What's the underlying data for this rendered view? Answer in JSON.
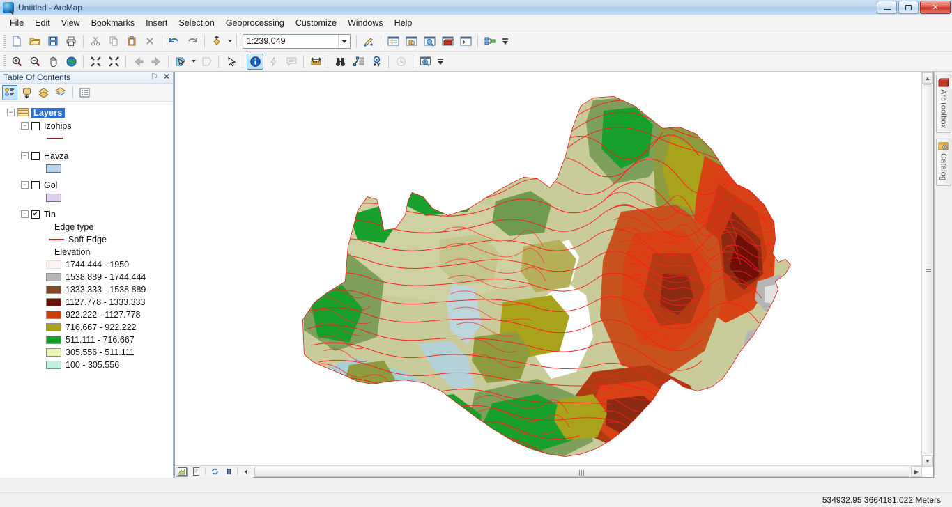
{
  "window": {
    "title": "Untitled - ArcMap",
    "app_icon": "arcmap-globe-icon",
    "minimize_label": "Minimize",
    "maximize_label": "Restore",
    "close_label": "Close"
  },
  "menubar": {
    "items": [
      {
        "label": "File"
      },
      {
        "label": "Edit"
      },
      {
        "label": "View"
      },
      {
        "label": "Bookmarks"
      },
      {
        "label": "Insert"
      },
      {
        "label": "Selection"
      },
      {
        "label": "Geoprocessing"
      },
      {
        "label": "Customize"
      },
      {
        "label": "Windows"
      },
      {
        "label": "Help"
      }
    ]
  },
  "standard_toolbar": {
    "buttons": [
      {
        "name": "new-map-icon",
        "title": "New"
      },
      {
        "name": "open-folder-icon",
        "title": "Open"
      },
      {
        "name": "save-icon",
        "title": "Save"
      },
      {
        "name": "print-icon",
        "title": "Print"
      },
      {
        "name": "cut-icon",
        "title": "Cut"
      },
      {
        "name": "copy-icon",
        "title": "Copy"
      },
      {
        "name": "paste-icon",
        "title": "Paste"
      },
      {
        "name": "delete-icon",
        "title": "Delete"
      },
      {
        "name": "undo-icon",
        "title": "Undo"
      },
      {
        "name": "redo-icon",
        "title": "Redo"
      },
      {
        "name": "add-data-icon",
        "title": "Add Data"
      }
    ],
    "scale": {
      "label": "Map Scale",
      "value": "1:239,049"
    },
    "right_buttons": [
      {
        "name": "editor-toolbar-icon",
        "title": "Editor Toolbar"
      },
      {
        "name": "table-of-contents-icon",
        "title": "Table Of Contents"
      },
      {
        "name": "catalog-window-icon",
        "title": "Catalog Window"
      },
      {
        "name": "search-window-icon",
        "title": "Search Window"
      },
      {
        "name": "arctoolbox-window-icon",
        "title": "ArcToolbox Window"
      },
      {
        "name": "python-window-icon",
        "title": "Python Window"
      },
      {
        "name": "model-builder-icon",
        "title": "ModelBuilder"
      }
    ]
  },
  "tools_toolbar": {
    "buttons": [
      {
        "name": "zoom-in-icon",
        "title": "Zoom In"
      },
      {
        "name": "zoom-out-icon",
        "title": "Zoom Out"
      },
      {
        "name": "pan-hand-icon",
        "title": "Pan"
      },
      {
        "name": "full-extent-globe-icon",
        "title": "Full Extent"
      },
      {
        "name": "fixed-zoom-in-icon",
        "title": "Fixed Zoom In"
      },
      {
        "name": "fixed-zoom-out-icon",
        "title": "Fixed Zoom Out"
      },
      {
        "name": "back-extent-icon",
        "title": "Go Back To Previous Extent"
      },
      {
        "name": "forward-extent-icon",
        "title": "Go To Next Extent"
      },
      {
        "name": "select-features-icon",
        "title": "Select Features"
      },
      {
        "name": "clear-selection-icon",
        "title": "Clear Selected Features"
      },
      {
        "name": "select-elements-arrow-icon",
        "title": "Select Elements"
      },
      {
        "name": "identify-icon",
        "title": "Identify",
        "active": true
      },
      {
        "name": "hyperlink-icon",
        "title": "Hyperlink"
      },
      {
        "name": "html-popup-icon",
        "title": "HTML Popup"
      },
      {
        "name": "measure-icon",
        "title": "Measure"
      },
      {
        "name": "find-binoculars-icon",
        "title": "Find"
      },
      {
        "name": "find-route-icon",
        "title": "Find Route"
      },
      {
        "name": "go-to-xy-icon",
        "title": "Go To XY"
      },
      {
        "name": "time-slider-icon",
        "title": "Time Slider"
      },
      {
        "name": "create-viewer-window-icon",
        "title": "Create Viewer Window"
      }
    ]
  },
  "toc": {
    "header_title": "Table Of Contents",
    "pin_glyph": "⚐",
    "close_glyph": "✕",
    "toolbar": [
      {
        "name": "list-by-drawing-order-icon",
        "title": "List By Drawing Order",
        "active": true
      },
      {
        "name": "list-by-source-icon",
        "title": "List By Source",
        "active": false
      },
      {
        "name": "list-by-visibility-icon",
        "title": "List By Visibility",
        "active": false
      },
      {
        "name": "list-by-selection-icon",
        "title": "List By Selection",
        "active": false
      },
      {
        "name": "toc-options-icon",
        "title": "Options",
        "active": false
      }
    ],
    "root": {
      "label": "Layers",
      "expander": "−",
      "selected": true
    },
    "layers": [
      {
        "label": "Izohips",
        "checked": false,
        "expander": "−",
        "symbol_type": "line",
        "symbol_color": "#8b1a1a"
      },
      {
        "label": "Havza",
        "checked": false,
        "expander": "−",
        "symbol_type": "fill",
        "symbol_color": "#b9d5ee"
      },
      {
        "label": "Gol",
        "checked": false,
        "expander": "−",
        "symbol_type": "fill",
        "symbol_color": "#ddcdee"
      }
    ],
    "tin_layer": {
      "label": "Tin",
      "checked": true,
      "check_glyph": "✔",
      "expander": "−",
      "edge_type_heading": "Edge type",
      "soft_edge": {
        "label": "Soft Edge",
        "color": "#cc2222"
      },
      "elevation_heading": "Elevation",
      "elevation_classes": [
        {
          "label": "1744.444 - 1950",
          "color": "#fbf2f2"
        },
        {
          "label": "1538.889 - 1744.444",
          "color": "#b5b5b5"
        },
        {
          "label": "1333.333 - 1538.889",
          "color": "#85492a"
        },
        {
          "label": "1127.778 - 1333.333",
          "color": "#6e1008"
        },
        {
          "label": "922.222 - 1127.778",
          "color": "#c9400b"
        },
        {
          "label": "716.667 - 922.222",
          "color": "#a9a31c"
        },
        {
          "label": "511.111 - 716.667",
          "color": "#15a02c"
        },
        {
          "label": "305.556 - 511.111",
          "color": "#eaf4b4"
        },
        {
          "label": "100 - 305.556",
          "color": "#bff0e4"
        }
      ]
    }
  },
  "map": {
    "data_frame_name": "Layers",
    "background": "#ffffff",
    "contour_color": "#ff1a1a",
    "bottom_tools": [
      {
        "name": "data-view-icon",
        "title": "Data View",
        "active": true
      },
      {
        "name": "layout-view-icon",
        "title": "Layout View",
        "active": false
      },
      {
        "name": "refresh-view-icon",
        "title": "Refresh View",
        "active": false
      },
      {
        "name": "pause-drawing-icon",
        "title": "Pause Drawing",
        "active": false
      },
      {
        "name": "scroll-left-arrow-icon",
        "title": "Scroll Left",
        "active": false
      }
    ]
  },
  "right_dock": {
    "tabs": [
      {
        "label": "ArcToolbox",
        "icon": "arctoolbox-icon"
      },
      {
        "label": "Catalog",
        "icon": "catalog-icon"
      }
    ]
  },
  "statusbar": {
    "coordinates": "534932.95  3664181.022 Meters"
  }
}
